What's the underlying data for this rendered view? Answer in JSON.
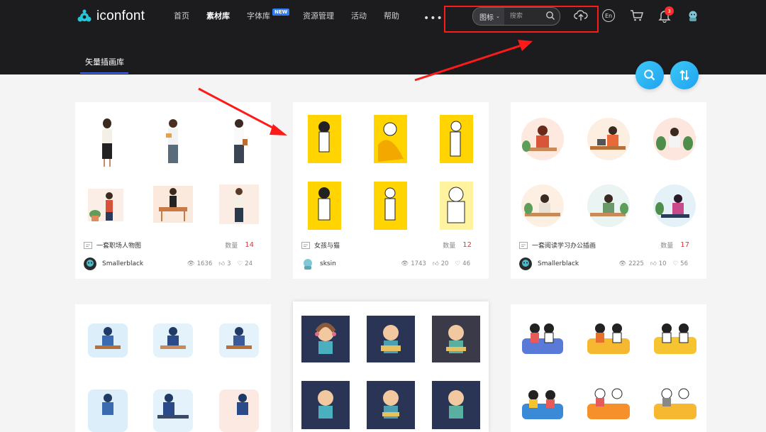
{
  "brand": {
    "name": "iconfont"
  },
  "nav": [
    {
      "label": "首页",
      "active": false
    },
    {
      "label": "素材库",
      "active": true
    },
    {
      "label": "字体库",
      "active": false,
      "badge": "NEW"
    },
    {
      "label": "资源管理",
      "active": false
    },
    {
      "label": "活动",
      "active": false
    },
    {
      "label": "帮助",
      "active": false
    }
  ],
  "nav_more": "•••",
  "search": {
    "type_label": "图标",
    "placeholder": "搜索"
  },
  "header_icons": {
    "upload": "cloud-upload-icon",
    "language": "En",
    "cart": "cart-icon",
    "notifications": "3",
    "avatar": "avatar-icon"
  },
  "subtab": {
    "label": "矢量插画库"
  },
  "fab": {
    "search": "search-icon",
    "sort": "sort-icon"
  },
  "cards": [
    {
      "title": "一套职场人物图",
      "qty_label": "数量",
      "count": "14",
      "author": "Smallerblack",
      "views": "1636",
      "likes": "3",
      "favorites": "24"
    },
    {
      "title": "女孩与猫",
      "qty_label": "数量",
      "count": "12",
      "author": "sksin",
      "views": "1743",
      "likes": "20",
      "favorites": "46"
    },
    {
      "title": "一套阅读学习办公插画",
      "qty_label": "数量",
      "count": "17",
      "author": "Smallerblack",
      "views": "2225",
      "likes": "10",
      "favorites": "56"
    }
  ],
  "colors": {
    "topbar": "#1c1c1e",
    "accent": "#3b63f5",
    "count_red": "#f23030",
    "highlight_red": "#ff1a1a",
    "yellow": "#ffd400",
    "fab": "#1ea2f0"
  }
}
